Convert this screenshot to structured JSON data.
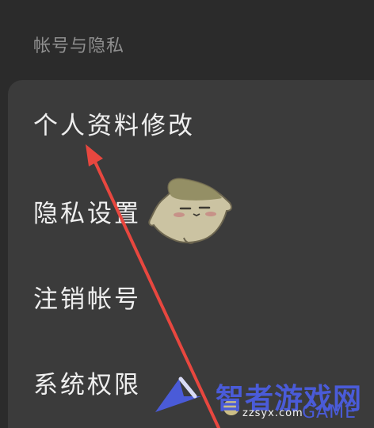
{
  "section": {
    "title": "帐号与隐私"
  },
  "menu": {
    "items": [
      {
        "label": "个人资料修改"
      },
      {
        "label": "隐私设置"
      },
      {
        "label": "注销帐号"
      },
      {
        "label": "系统权限"
      }
    ]
  },
  "watermark": {
    "text": "智者游戏网",
    "sub": "zzsyx.com",
    "game": "GAME"
  },
  "colors": {
    "background": "#2b2b2b",
    "card": "#3b3b3b",
    "arrow": "#e8473f",
    "watermark": "#4a5bd8"
  }
}
